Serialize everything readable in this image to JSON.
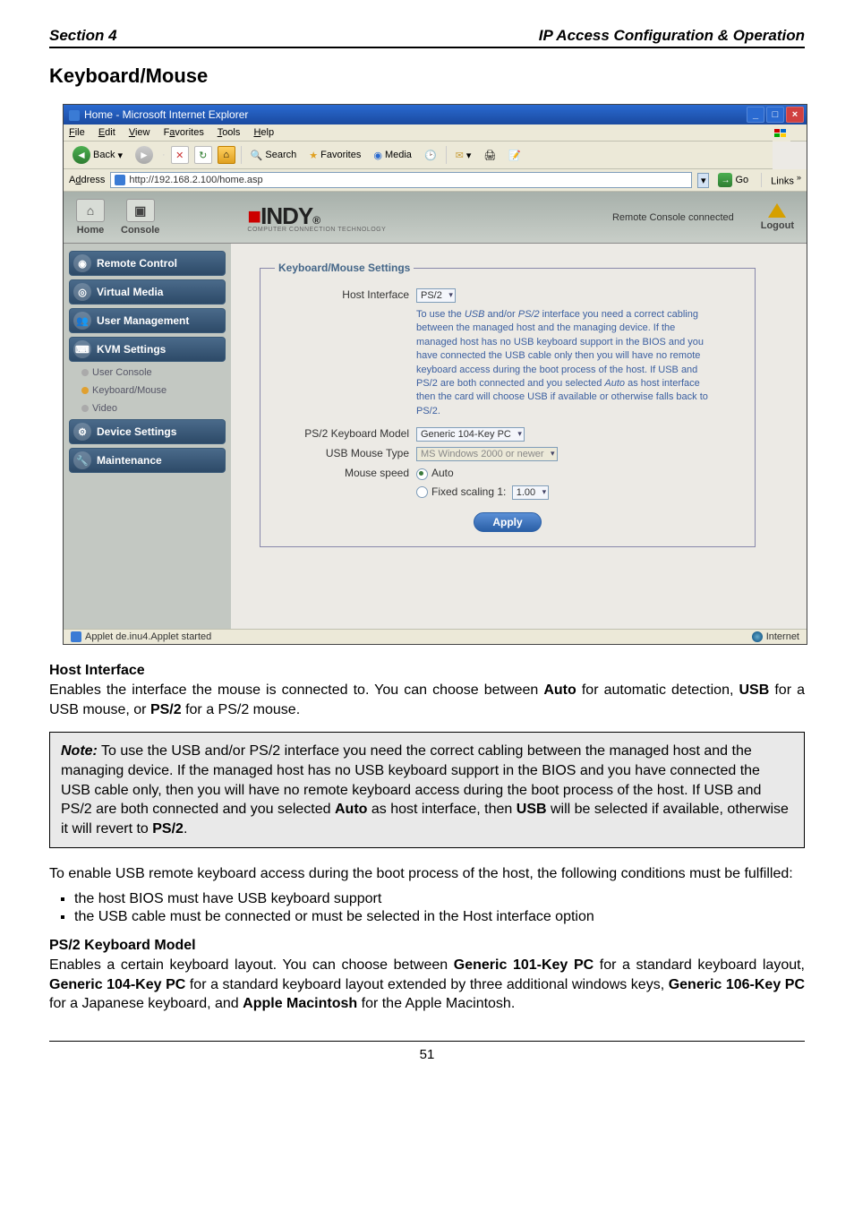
{
  "header": {
    "left": "Section 4",
    "right": "IP Access Configuration & Operation"
  },
  "page_title": "Keyboard/Mouse",
  "browser": {
    "title": "Home - Microsoft Internet Explorer",
    "menus": {
      "file": "File",
      "edit": "Edit",
      "view": "View",
      "favorites": "Favorites",
      "tools": "Tools",
      "help": "Help"
    },
    "toolbar": {
      "back": "Back",
      "search": "Search",
      "favorites": "Favorites",
      "media": "Media"
    },
    "address_label": "Address",
    "address_value": "http://192.168.2.100/home.asp",
    "go": "Go",
    "links": "Links",
    "status_left": "Applet de.inu4.Applet started",
    "status_right": "Internet"
  },
  "app": {
    "home": "Home",
    "console": "Console",
    "brand_sub": "COMPUTER CONNECTION TECHNOLOGY",
    "remote_status": "Remote Console connected",
    "logout": "Logout",
    "nav": {
      "remote_control": "Remote Control",
      "virtual_media": "Virtual Media",
      "user_management": "User Management",
      "kvm_settings": "KVM Settings",
      "user_console": "User Console",
      "keyboard_mouse": "Keyboard/Mouse",
      "video": "Video",
      "device_settings": "Device Settings",
      "maintenance": "Maintenance"
    },
    "form": {
      "legend": "Keyboard/Mouse Settings",
      "host_interface_label": "Host Interface",
      "host_interface_value": "PS/2",
      "help_line1": "To use the ",
      "help_usb": "USB",
      "help_and": " and/or ",
      "help_ps2": "PS/2",
      "help_rest": " interface you need a correct cabling between the managed host and the managing device. If the managed host has no USB keyboard support in the BIOS and you have connected the USB cable only then you will have no remote keyboard access during the boot process of the host. If USB and PS/2 are both connected and you selected ",
      "help_auto": "Auto",
      "help_rest2": " as host interface then the card will choose USB if available or otherwise falls back to PS/2.",
      "ps2_model_label": "PS/2 Keyboard Model",
      "ps2_model_value": "Generic 104-Key PC",
      "usb_mouse_label": "USB Mouse Type",
      "usb_mouse_value": "MS Windows 2000 or newer",
      "mouse_speed_label": "Mouse speed",
      "mouse_speed_auto": "Auto",
      "mouse_speed_fixed": "Fixed scaling 1:",
      "mouse_speed_fixed_value": "1.00",
      "apply": "Apply"
    }
  },
  "doc": {
    "h_host": "Host Interface",
    "p_host_a": "Enables the interface the mouse is connected to. You can choose between ",
    "p_host_b": " for automatic detection, ",
    "p_host_c": " for a USB mouse, or ",
    "p_host_d": " for a PS/2 mouse.",
    "auto": "Auto",
    "usb": "USB",
    "ps2": "PS/2",
    "note_label": "Note:",
    "note_body_a": " To use the USB and/or PS/2 interface you need the correct cabling between the managed host and the managing device. If the managed host has no USB keyboard support in the BIOS and you have connected the USB cable only, then you will have no remote keyboard access during the boot process of the host. If USB and PS/2 are both connected and you selected ",
    "note_body_b": " as host interface, then ",
    "note_body_c": " will be selected if available, otherwise it will revert to ",
    "note_body_d": ".",
    "p_enable": "To enable USB remote keyboard access during the boot process of the host, the following conditions must be fulfilled:",
    "li1": "the host BIOS must have USB keyboard support",
    "li2": "the USB cable must be connected or must be selected in the Host interface option",
    "h_ps2": "PS/2 Keyboard Model",
    "p_ps2_a": "Enables a certain keyboard layout. You can choose between ",
    "g101": "Generic 101-Key PC",
    "p_ps2_b": " for a standard keyboard layout, ",
    "g104": "Generic 104-Key PC",
    "p_ps2_c": " for a standard keyboard layout extended by three additional windows keys, ",
    "g106": "Generic 106-Key PC",
    "p_ps2_d": " for a Japanese keyboard, and ",
    "apple": "Apple Macintosh",
    "p_ps2_e": " for the Apple Macintosh.",
    "pagenum": "51"
  }
}
